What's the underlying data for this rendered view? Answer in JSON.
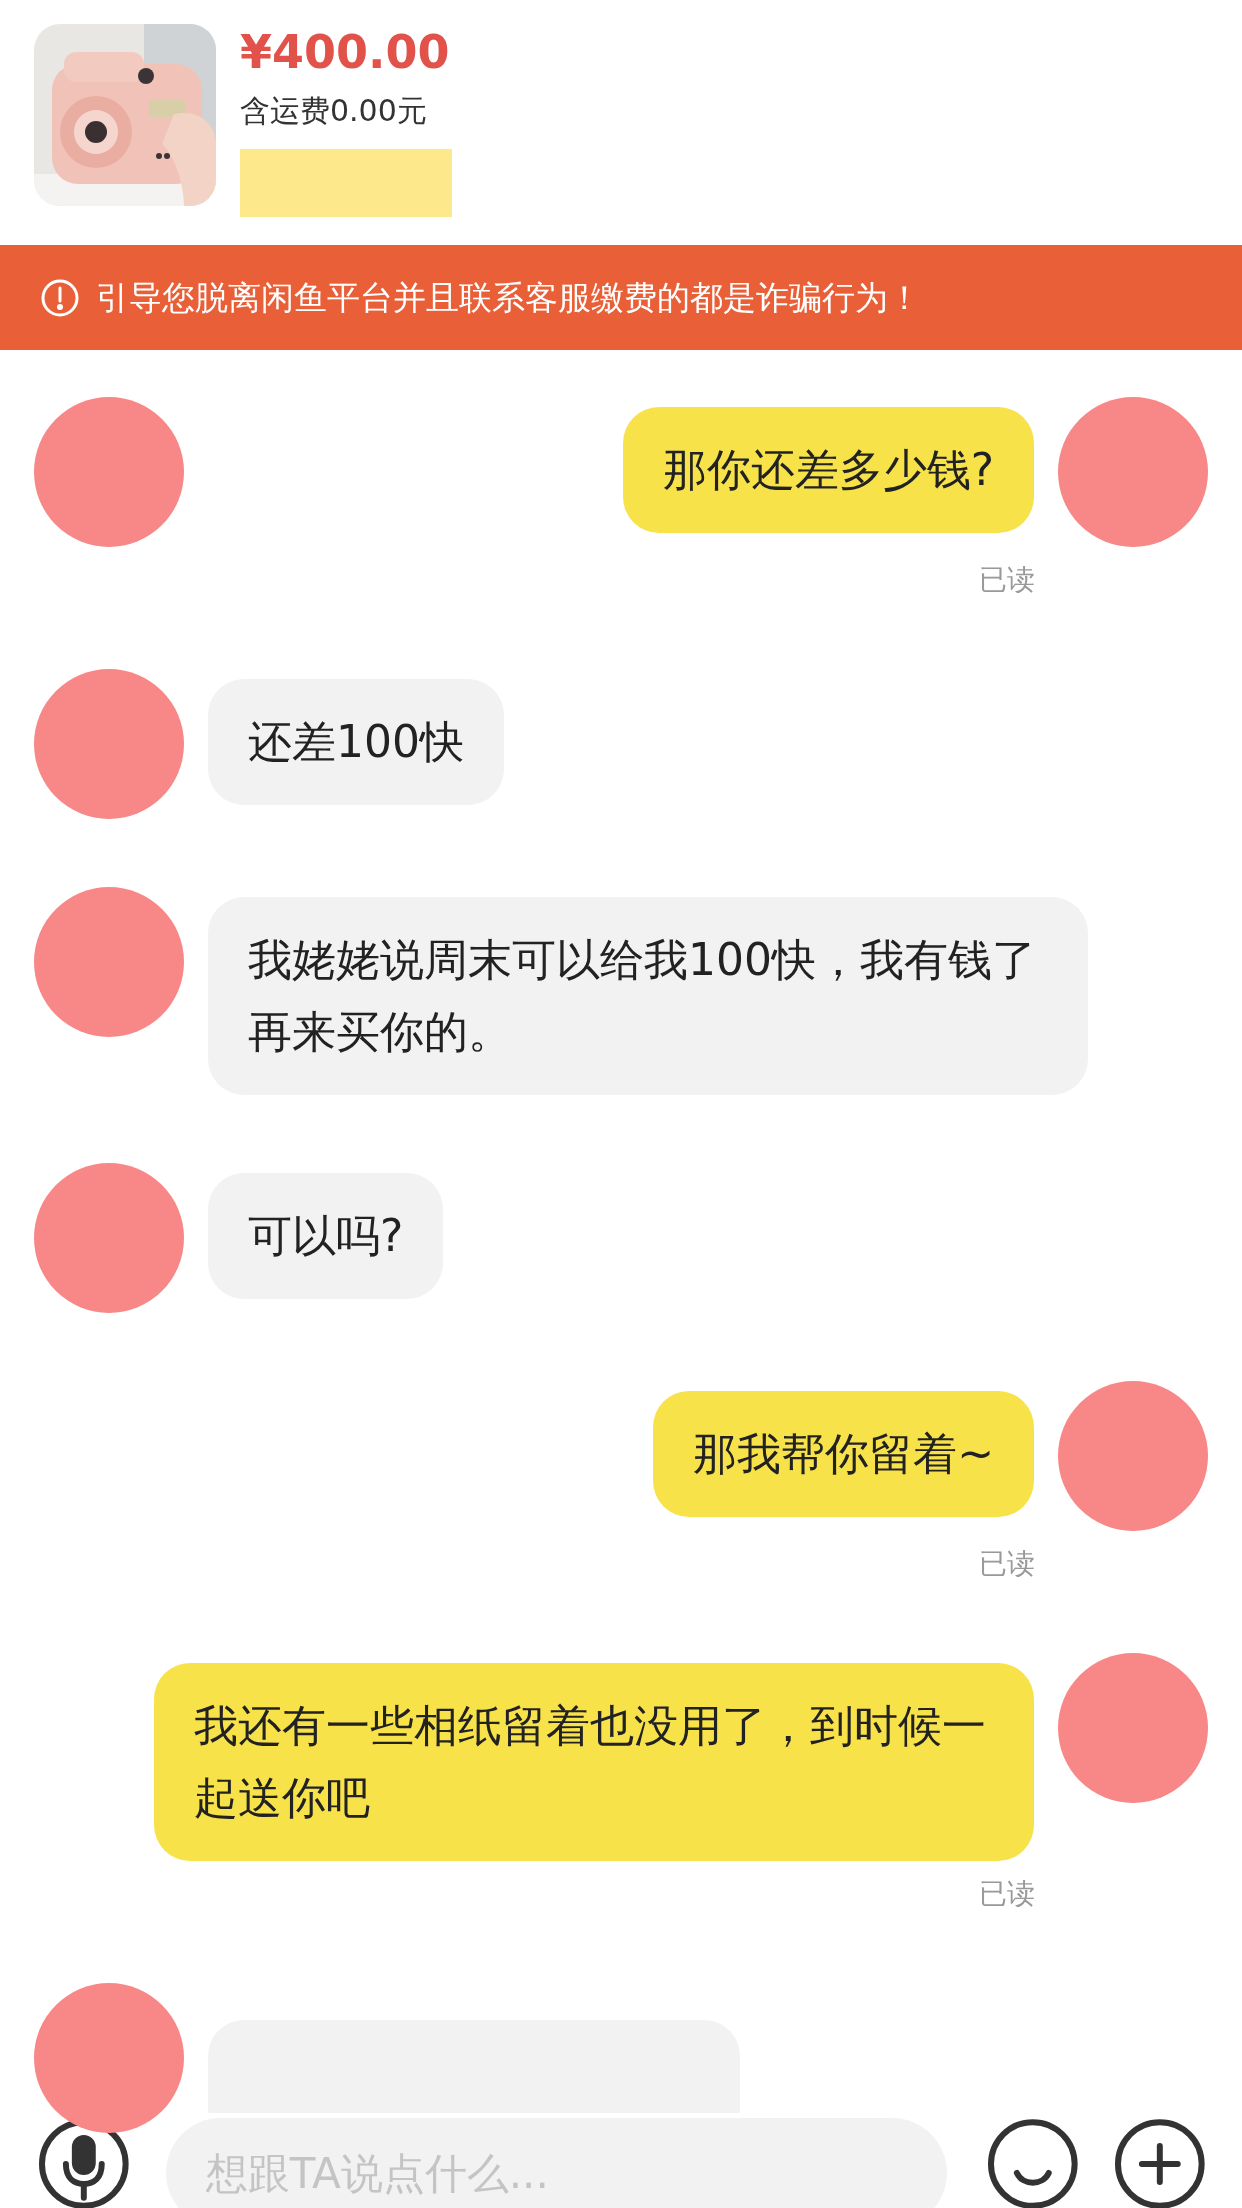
{
  "product": {
    "price": "¥400.00",
    "shipping": "含运费0.00元"
  },
  "warning_banner": {
    "text": "引导您脱离闲鱼平台并且联系客服缴费的都是诈骗行为！"
  },
  "messages": [
    {
      "kind": "self",
      "text": "那你还差多少钱?",
      "receipt": "已读",
      "extra_avatar": true
    },
    {
      "kind": "other",
      "text": "还差100快"
    },
    {
      "kind": "other",
      "text": "我姥姥说周末可以给我100快，我有钱了再来买你的。"
    },
    {
      "kind": "other",
      "text": "可以吗?"
    },
    {
      "kind": "self",
      "text": "那我帮你留着~",
      "receipt": "已读"
    },
    {
      "kind": "self",
      "text": "我还有一些相纸留着也没用了，到时候一起送你吧",
      "receipt": "已读"
    },
    {
      "kind": "other"
    }
  ],
  "input_bar": {
    "placeholder": "想跟TA说点什么..."
  }
}
